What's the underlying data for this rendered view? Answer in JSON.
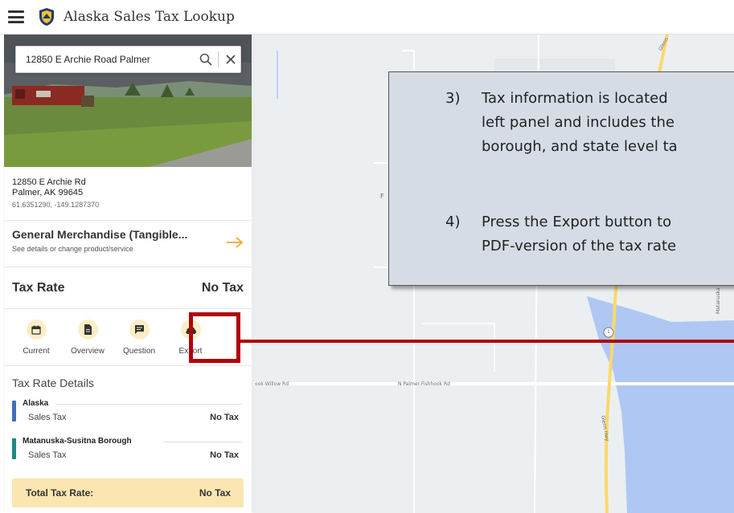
{
  "header": {
    "title": "Alaska Sales Tax Lookup"
  },
  "search": {
    "value": "12850 E Archie Road Palmer"
  },
  "address": {
    "line1": "12850 E Archie Rd",
    "line2": "Palmer, AK 99645",
    "coords": "61.6351290, -149.1287370"
  },
  "product": {
    "name": "General Merchandise (Tangible...",
    "sub": "See details or change product/service"
  },
  "tax_rate": {
    "label": "Tax Rate",
    "value": "No Tax"
  },
  "actions": [
    {
      "label": "Current",
      "icon": "calendar-icon"
    },
    {
      "label": "Overview",
      "icon": "document-icon"
    },
    {
      "label": "Question",
      "icon": "chat-icon"
    },
    {
      "label": "Export",
      "icon": "cloud-download-icon"
    }
  ],
  "details": {
    "title": "Tax Rate Details",
    "jurisdictions": [
      {
        "name": "Alaska",
        "tax_label": "Sales Tax",
        "value": "No Tax",
        "color": "#3d6fb8"
      },
      {
        "name": "Matanuska-Susitna Borough",
        "tax_label": "Sales Tax",
        "value": "No Tax",
        "color": "#20887e"
      }
    ],
    "total_label": "Total Tax Rate:",
    "total_value": "No Tax"
  },
  "map": {
    "road_labels": {
      "willow": "ook-Willow Rd",
      "fishhook": "N Palmer-Fishhook Rd",
      "glenn_hwy": "Glenn Hwy",
      "glenn_top": "Glenn",
      "matanuska": "Matanuska",
      "shield": "1",
      "f": "F"
    },
    "colors": {
      "land": "#eceff1",
      "water": "#aec8f3",
      "highway": "#fbd96a"
    }
  },
  "callout": {
    "steps": [
      {
        "num": "3)",
        "lines": [
          "Tax information is located",
          "left panel and includes the",
          "borough, and state level ta"
        ]
      },
      {
        "num": "4)",
        "lines": [
          "Press the Export button to",
          "PDF-version of the tax rate"
        ]
      }
    ]
  },
  "colors": {
    "accent_red": "#b0000b",
    "action_circle": "#fbeec7",
    "total_bg": "#fbe6b2",
    "callout_bg": "#d6dce5"
  }
}
